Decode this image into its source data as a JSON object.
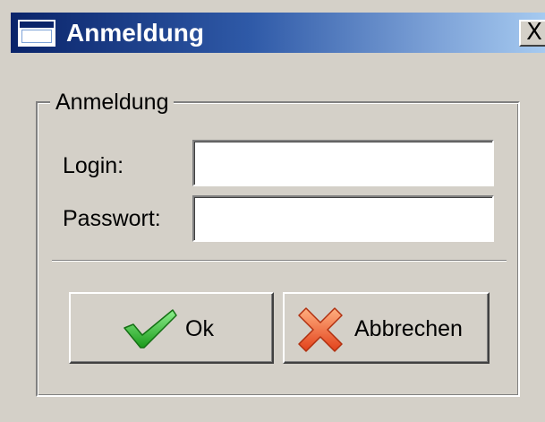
{
  "window": {
    "title": "Anmeldung",
    "close_glyph": "X"
  },
  "form": {
    "group_title": "Anmeldung",
    "login_label": "Login:",
    "login_value": "",
    "password_label": "Passwort:",
    "password_value": ""
  },
  "buttons": {
    "ok_label": "Ok",
    "ok_icon": "checkmark-icon",
    "cancel_label": "Abbrechen",
    "cancel_icon": "cross-icon"
  },
  "colors": {
    "title_gradient_start": "#0a246a",
    "title_gradient_end": "#a6caf0",
    "face": "#d4d0c8",
    "ok_icon_green": "#2ebd2e",
    "cancel_icon_orange": "#ee5a1c"
  }
}
